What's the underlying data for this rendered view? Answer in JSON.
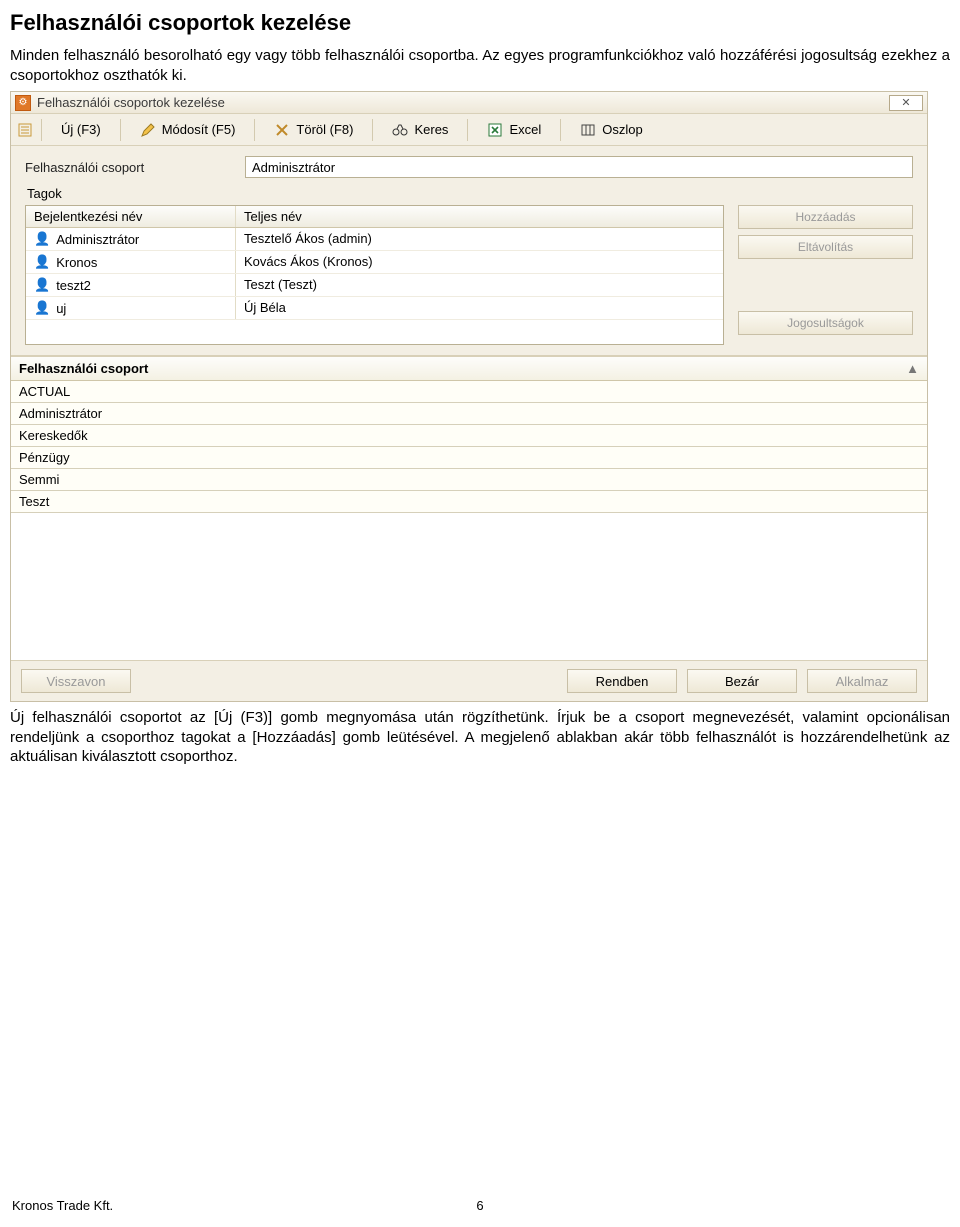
{
  "doc": {
    "title": "Felhasználói csoportok kezelése",
    "intro": "Minden felhasználó besorolható egy vagy több felhasználói csoportba. Az egyes programfunkciókhoz való hozzáférési jogosultság ezekhez a csoportokhoz oszthatók ki.",
    "outro": "Új felhasználói csoportot az [Új (F3)] gomb megnyomása után rögzíthetünk. Írjuk be a csoport megnevezését, valamint opcionálisan rendeljünk a csoporthoz tagokat a [Hozzáadás] gomb leütésével. A megjelenő ablakban akár több felhasználót is hozzárendelhetünk az aktuálisan kiválasztott csoporthoz.",
    "footer_company": "Kronos Trade Kft.",
    "footer_page": "6"
  },
  "window": {
    "title": "Felhasználói csoportok kezelése",
    "close_glyph": "✕"
  },
  "toolbar": {
    "new": "Új (F3)",
    "modify": "Módosít (F5)",
    "delete": "Töröl (F8)",
    "search": "Keres",
    "excel": "Excel",
    "column": "Oszlop"
  },
  "form": {
    "group_label": "Felhasználói csoport",
    "group_value": "Adminisztrátor",
    "members_label": "Tagok",
    "col_login": "Bejelentkezési név",
    "col_full": "Teljes név",
    "rows": [
      {
        "login": "Adminisztrátor",
        "full": "Tesztelő Ákos (admin)"
      },
      {
        "login": "Kronos",
        "full": "Kovács Ákos (Kronos)"
      },
      {
        "login": "teszt2",
        "full": "Teszt (Teszt)"
      },
      {
        "login": "uj",
        "full": "Új Béla"
      }
    ],
    "btn_add": "Hozzáadás",
    "btn_remove": "Eltávolítás",
    "btn_perms": "Jogosultságok"
  },
  "grid": {
    "header": "Felhasználói csoport",
    "sort_glyph": "",
    "rows": [
      "ACTUAL",
      "Adminisztrátor",
      "Kereskedők",
      "Pénzügy",
      "Semmi",
      "Teszt"
    ]
  },
  "bottom": {
    "undo": "Visszavon",
    "ok": "Rendben",
    "close": "Bezár",
    "apply": "Alkalmaz"
  }
}
